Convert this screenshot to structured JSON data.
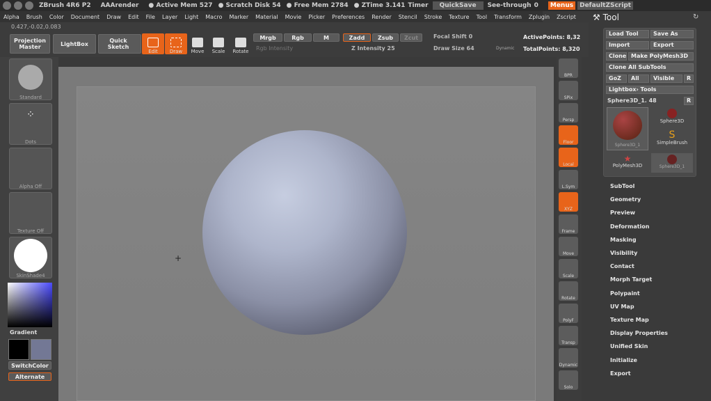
{
  "title_bar": {
    "app": "ZBrush 4R6 P2",
    "render": "AAArender",
    "mem": "● Active Mem 527",
    "scratch": "● Scratch Disk 54",
    "free": "● Free Mem 2784",
    "ztime": "● ZTime 3.141",
    "timer": "Timer",
    "quicksave": "QuickSave",
    "seethrough": "See-through",
    "seethrough_val": "0",
    "menus": "Menus",
    "script": "DefaultZScript"
  },
  "menu": [
    "Alpha",
    "Brush",
    "Color",
    "Document",
    "Draw",
    "Edit",
    "File",
    "Layer",
    "Light",
    "Macro",
    "Marker",
    "Material",
    "Movie",
    "Picker",
    "Preferences",
    "Render",
    "Stencil",
    "Stroke",
    "Texture",
    "Tool",
    "Transform",
    "Zplugin",
    "Zscript"
  ],
  "coords": "0.427,-0.02,0.083",
  "shelf": {
    "projection": "Projection Master",
    "lightbox": "LightBox",
    "quicksketch": "Quick Sketch",
    "edit": "Edit",
    "draw": "Draw",
    "move": "Move",
    "scale": "Scale",
    "rotate": "Rotate",
    "mrgb": "Mrgb",
    "rgb": "Rgb",
    "m": "M",
    "zadd": "Zadd",
    "zsub": "Zsub",
    "zcut": "Zcut",
    "rgb_int": "Rgb Intensity",
    "z_int": "Z Intensity",
    "z_int_val": "25",
    "focal": "Focal Shift",
    "focal_val": "0",
    "draw_size": "Draw Size",
    "draw_size_val": "64",
    "dynamic": "Dynamic",
    "active_points": "ActivePoints: 8,32",
    "total_points": "TotalPoints: 8,320"
  },
  "left": {
    "standard": "Standard",
    "dots": "Dots",
    "alpha": "Alpha Off",
    "texture": "Texture Off",
    "material": "SkinShade4",
    "gradient": "Gradient",
    "switch": "SwitchColor",
    "alternate": "Alternate"
  },
  "right": [
    "BPR",
    "SPix",
    "Persp",
    "Floor",
    "Local",
    "L.Sym",
    "XYZ",
    "Frame",
    "Move",
    "Scale",
    "Rotate",
    "PolyF",
    "Transp",
    "Dynamic",
    "Solo"
  ],
  "tool": {
    "title": "Tool",
    "load": "Load Tool",
    "save": "Save As",
    "import": "Import",
    "export": "Export",
    "clone": "Clone",
    "polymesh": "Make PolyMesh3D",
    "clone_all": "Clone All SubTools",
    "goz": "GoZ",
    "all": "All",
    "visible": "Visible",
    "r": "R",
    "lightbox_tools": "Lightbox› Tools",
    "current": "Sphere3D_1. 48",
    "thumbs": [
      "Sphere3D_1",
      "Sphere3D",
      "SimpleBrush",
      "PolyMesh3D",
      "Sphere3D_1"
    ]
  },
  "sections": [
    "SubTool",
    "Geometry",
    "Preview",
    "Deformation",
    "Masking",
    "Visibility",
    "Contact",
    "Morph Target",
    "Polypaint",
    "UV Map",
    "Texture Map",
    "Display Properties",
    "Unified Skin",
    "Initialize",
    "Export"
  ]
}
